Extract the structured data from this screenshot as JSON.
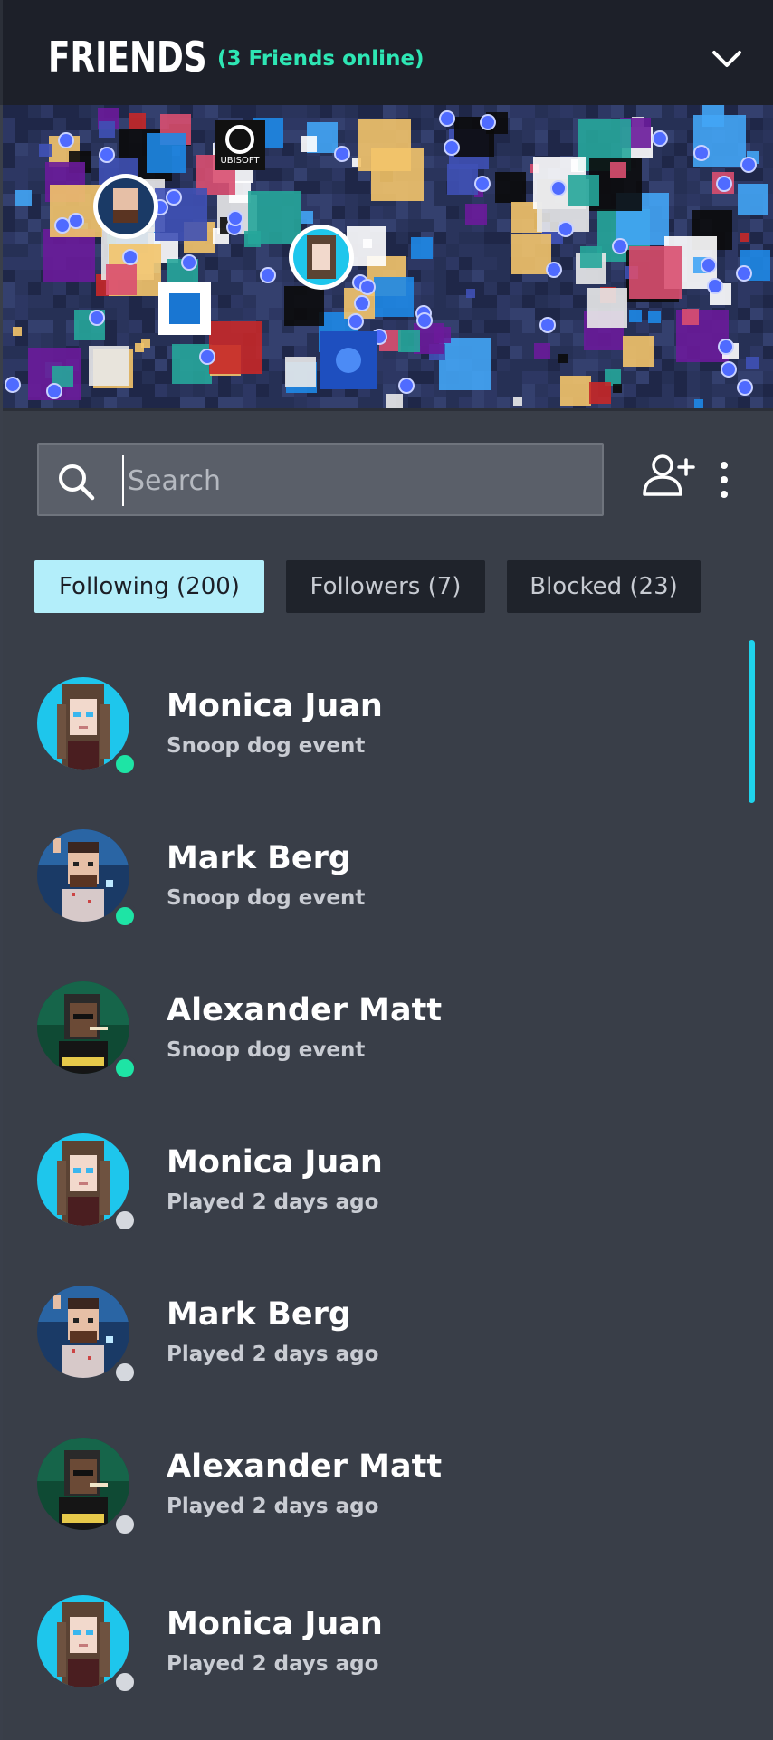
{
  "header": {
    "title": "FRIENDS",
    "online_text": "(3 Friends online)"
  },
  "search": {
    "placeholder": "Search",
    "value": ""
  },
  "tabs": [
    {
      "label": "Following (200)",
      "active": true
    },
    {
      "label": "Followers (7)",
      "active": false
    },
    {
      "label": "Blocked (23)",
      "active": false
    }
  ],
  "friends": [
    {
      "name": "Monica Juan",
      "status": "Snoop dog event",
      "online": true,
      "avatar": "female-avatar"
    },
    {
      "name": "Mark Berg",
      "status": "Snoop dog event",
      "online": true,
      "avatar": "male-avatar"
    },
    {
      "name": "Alexander Matt",
      "status": "Snoop dog event",
      "online": true,
      "avatar": "snoop-avatar"
    },
    {
      "name": "Monica Juan",
      "status": "Played 2 days ago",
      "online": false,
      "avatar": "female-avatar"
    },
    {
      "name": "Mark Berg",
      "status": "Played 2 days ago",
      "online": false,
      "avatar": "male-avatar"
    },
    {
      "name": "Alexander Matt",
      "status": "Played 2 days ago",
      "online": false,
      "avatar": "snoop-avatar"
    },
    {
      "name": "Monica Juan",
      "status": "Played 2 days ago",
      "online": false,
      "avatar": "female-avatar"
    }
  ],
  "map": {
    "brand_logos": [
      "UBISOFT"
    ]
  },
  "colors": {
    "accent": "#2ee6b4",
    "tab_active_bg": "#b3eefa",
    "online_dot": "#1ee4a5",
    "offline_dot": "#d5d8de",
    "scroll_indicator": "#1fd3ec"
  }
}
